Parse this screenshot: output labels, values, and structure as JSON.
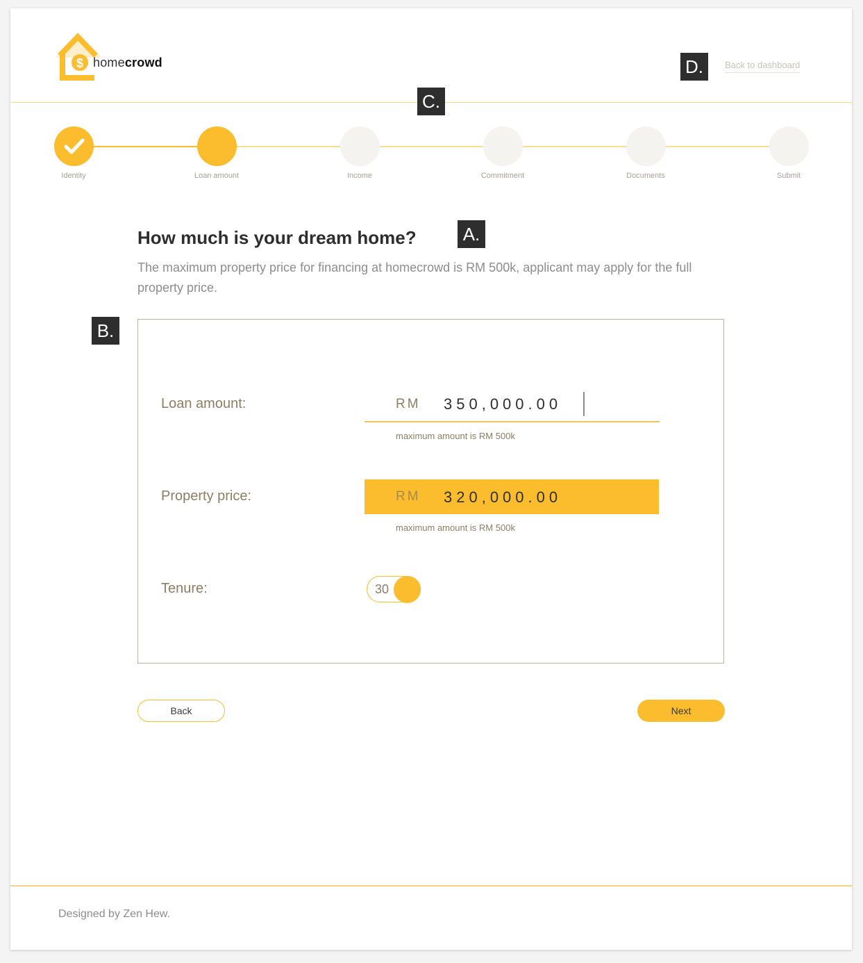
{
  "brand": {
    "logo_light": "home",
    "logo_bold": "crowd"
  },
  "header": {
    "back_link": "Back to dashboard"
  },
  "annotations": {
    "a": "A.",
    "b": "B.",
    "c": "C.",
    "d": "D."
  },
  "stepper": {
    "steps": [
      {
        "label": "Identity",
        "state": "done"
      },
      {
        "label": "Loan amount",
        "state": "active"
      },
      {
        "label": "Income",
        "state": "todo"
      },
      {
        "label": "Commitment",
        "state": "todo"
      },
      {
        "label": "Documents",
        "state": "todo"
      },
      {
        "label": "Submit",
        "state": "todo"
      }
    ]
  },
  "question": {
    "title": "How much is your dream home?",
    "description": "The maximum property price for financing at homecrowd is RM 500k, applicant may apply for the full property price."
  },
  "form": {
    "loan": {
      "label": "Loan amount:",
      "currency": "RM",
      "value": "350,000.00",
      "hint": "maximum amount is RM 500k"
    },
    "property": {
      "label": "Property price:",
      "currency": "RM",
      "value": "320,000.00",
      "hint": "maximum amount is RM 500k"
    },
    "tenure": {
      "label": "Tenure:",
      "value": "30"
    }
  },
  "buttons": {
    "back": "Back",
    "next": "Next"
  },
  "footer": {
    "credit": "Designed by Zen Hew."
  },
  "colors": {
    "accent": "#fbbd2e",
    "label": "#8b7e63",
    "muted": "#8d8d8d",
    "inactive_step": "#f5f3ef"
  }
}
